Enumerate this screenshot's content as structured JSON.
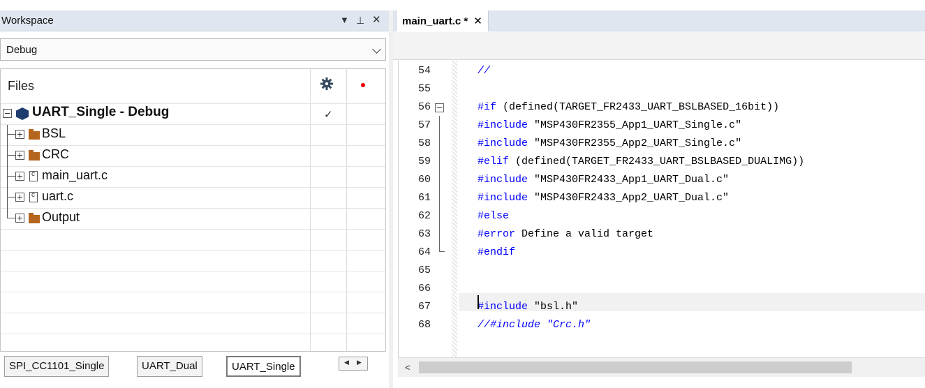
{
  "workspace": {
    "title": "Workspace",
    "controls": [
      "▼",
      "⊥",
      "✕"
    ],
    "config_selected": "Debug",
    "tree_header": "Files",
    "project": "UART_Single - Debug",
    "items": [
      {
        "label": "BSL",
        "type": "folder"
      },
      {
        "label": "CRC",
        "type": "folder"
      },
      {
        "label": "main_uart.c",
        "type": "file"
      },
      {
        "label": "uart.c",
        "type": "file"
      },
      {
        "label": "Output",
        "type": "folder"
      }
    ],
    "bottom_tabs": [
      "SPI_CC1101_Single",
      "UART_Dual",
      "UART_Single"
    ],
    "active_bottom_tab": "UART_Single"
  },
  "editor": {
    "tab_label": "main_uart.c *",
    "tab_close": "✕",
    "lines": [
      {
        "n": "54",
        "code": "//",
        "style": "cmt"
      },
      {
        "n": "55",
        "code": "",
        "style": "plain"
      },
      {
        "n": "56",
        "kw": "#if",
        "code": " (defined(TARGET_FR2433_UART_BSLBASED_16bit))",
        "style": "kw"
      },
      {
        "n": "57",
        "kw": "#include",
        "code": " \"MSP430FR2355_App1_UART_Single.c\"",
        "style": "kw"
      },
      {
        "n": "58",
        "kw": "#include",
        "code": " \"MSP430FR2355_App2_UART_Single.c\"",
        "style": "kw"
      },
      {
        "n": "59",
        "kw": "#elif",
        "code": " (defined(TARGET_FR2433_UART_BSLBASED_DUALIMG))",
        "style": "kw"
      },
      {
        "n": "60",
        "kw": "#include",
        "code": " \"MSP430FR2433_App1_UART_Dual.c\"",
        "style": "kw"
      },
      {
        "n": "61",
        "kw": "#include",
        "code": " \"MSP430FR2433_App2_UART_Dual.c\"",
        "style": "kw"
      },
      {
        "n": "62",
        "kw": "#else",
        "code": "",
        "style": "kw"
      },
      {
        "n": "63",
        "kw": "#error",
        "code": " Define a valid target",
        "style": "kw"
      },
      {
        "n": "64",
        "kw": "#endif",
        "code": "",
        "style": "kw"
      },
      {
        "n": "65",
        "code": "",
        "style": "plain"
      },
      {
        "n": "66",
        "code": "",
        "style": "plain"
      },
      {
        "n": "67",
        "kw": "#include",
        "code": " \"bsl.h\"",
        "style": "kw"
      },
      {
        "n": "68",
        "code": "//#include \"Crc.h\"",
        "style": "cmt"
      }
    ]
  }
}
